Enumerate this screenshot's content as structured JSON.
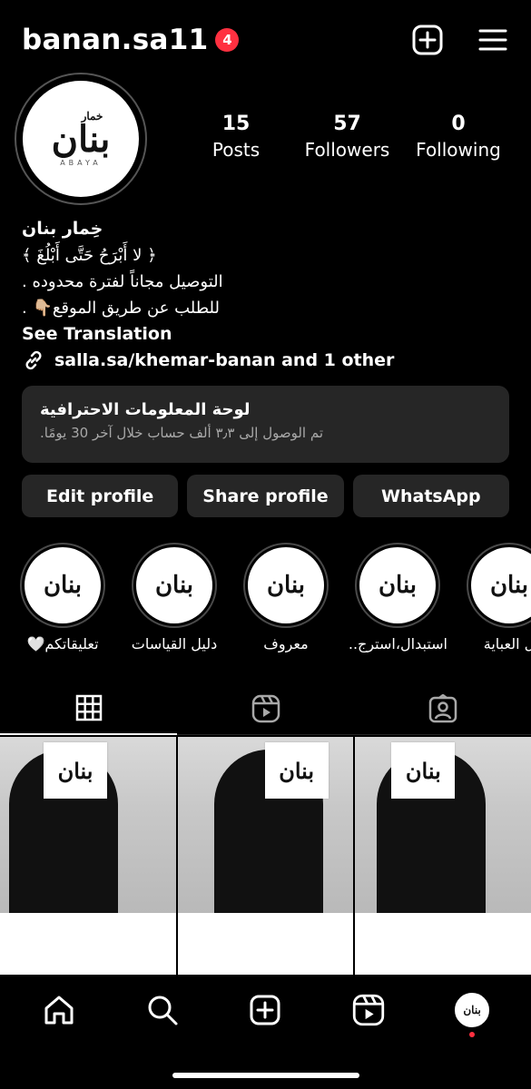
{
  "header": {
    "username": "banan.sa11",
    "notification_count": "4"
  },
  "profile": {
    "logo_text": "بنان",
    "logo_small": "خمار",
    "logo_sub": "ABAYA",
    "stats": [
      {
        "value": "15",
        "label": "Posts"
      },
      {
        "value": "57",
        "label": "Followers"
      },
      {
        "value": "0",
        "label": "Following"
      }
    ]
  },
  "bio": {
    "name": "خِمار بنان",
    "line1": "﴿ لا أَبْرَحُ حَتَّى أَبْلُغَ ﴾",
    "line2": "التوصيل مجاناً لفترة محدوده .",
    "line3": "للطلب عن طريق الموقع👇🏼 .",
    "see_translation": "See Translation"
  },
  "link": {
    "text": "salla.sa/khemar-banan and 1 other"
  },
  "dashboard": {
    "title": "لوحة المعلومات الاحترافية",
    "subtitle": "تم الوصول إلى ٣٫٣ ألف حساب خلال آخر 30 يومًا."
  },
  "buttons": {
    "edit": "Edit profile",
    "share": "Share profile",
    "whatsapp": "WhatsApp"
  },
  "highlights": [
    {
      "label": "تعليقاتكم🤍"
    },
    {
      "label": "دليل القياسات"
    },
    {
      "label": "معروف"
    },
    {
      "label": "استبدال،استرج..."
    },
    {
      "label": "ل العباية"
    }
  ],
  "tabs": [
    {
      "icon": "grid-icon",
      "active": true
    },
    {
      "icon": "reels-icon",
      "active": false
    },
    {
      "icon": "tagged-icon",
      "active": false
    }
  ],
  "nav": [
    {
      "icon": "home-icon"
    },
    {
      "icon": "search-icon"
    },
    {
      "icon": "create-icon"
    },
    {
      "icon": "reels-icon"
    },
    {
      "icon": "profile-avatar"
    }
  ],
  "colors": {
    "background": "#000000",
    "card": "#262626",
    "badge": "#ff3040",
    "subtext": "#a8a8a8"
  }
}
